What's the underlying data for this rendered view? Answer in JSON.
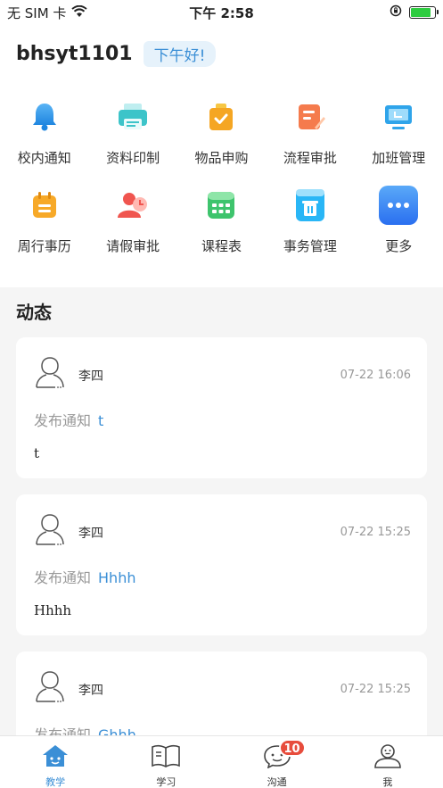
{
  "status_bar": {
    "carrier": "无 SIM 卡",
    "time": "下午 2:58",
    "icons": [
      "wifi-icon",
      "rotation-lock-icon",
      "battery-charging-icon"
    ],
    "battery_level": 0.85
  },
  "header": {
    "username": "bhsyt1101",
    "greeting": "下午好!"
  },
  "apps": [
    {
      "label": "校内通知",
      "icon": "bell-icon"
    },
    {
      "label": "资料印制",
      "icon": "printer-icon"
    },
    {
      "label": "物品申购",
      "icon": "purchase-bag-icon"
    },
    {
      "label": "流程审批",
      "icon": "approval-doc-icon"
    },
    {
      "label": "加班管理",
      "icon": "monitor-icon"
    },
    {
      "label": "周行事历",
      "icon": "calendar-icon"
    },
    {
      "label": "请假审批",
      "icon": "leave-person-clock-icon"
    },
    {
      "label": "课程表",
      "icon": "timetable-icon"
    },
    {
      "label": "事务管理",
      "icon": "trash-bin-icon"
    },
    {
      "label": "更多",
      "icon": "more-dots-icon"
    }
  ],
  "feed": {
    "title": "动态",
    "posts": [
      {
        "author": "李四",
        "time": "07-22 16:06",
        "action": "发布通知",
        "subject": "t",
        "body": "t"
      },
      {
        "author": "李四",
        "time": "07-22 15:25",
        "action": "发布通知",
        "subject": "Hhhh",
        "body": "Hhhh"
      },
      {
        "author": "李四",
        "time": "07-22 15:25",
        "action": "发布通知",
        "subject": "Ghhh",
        "body": ""
      }
    ]
  },
  "tabbar": {
    "tabs": [
      {
        "label": "教学",
        "icon": "teaching-house-icon",
        "active": true
      },
      {
        "label": "学习",
        "icon": "book-icon",
        "active": false
      },
      {
        "label": "沟通",
        "icon": "chat-icon",
        "active": false,
        "badge": "10"
      },
      {
        "label": "我",
        "icon": "profile-icon",
        "active": false
      }
    ]
  },
  "colors": {
    "accent": "#3b8fd6",
    "badge_red": "#e74c3c",
    "background": "#f5f5f5"
  }
}
